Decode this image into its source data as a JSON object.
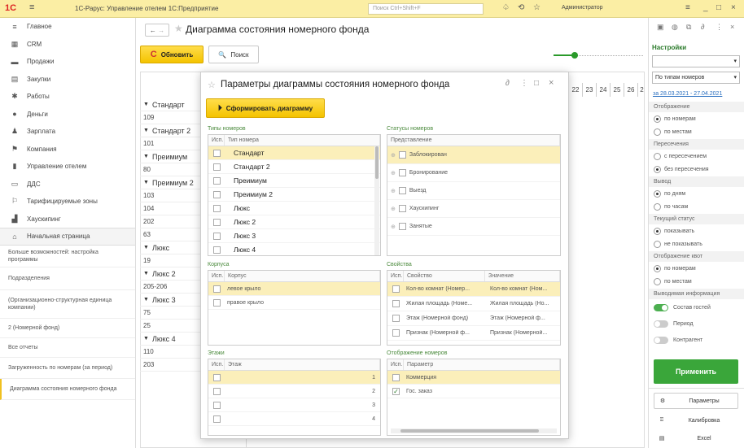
{
  "titlebar": {
    "app_title": "1С-Рарус: Управление отелем 1С:Предприятие",
    "search_placeholder": "Поиск Ctrl+Shift+F",
    "user": "Администратор"
  },
  "sidebar": {
    "items": [
      {
        "label": "Главное",
        "icon": "hamburger-icon"
      },
      {
        "label": "CRM",
        "icon": "crm-icon"
      },
      {
        "label": "Продажи",
        "icon": "sales-icon"
      },
      {
        "label": "Закупки",
        "icon": "purchases-icon"
      },
      {
        "label": "Работы",
        "icon": "works-icon"
      },
      {
        "label": "Деньги",
        "icon": "money-icon"
      },
      {
        "label": "Зарплата",
        "icon": "salary-icon"
      },
      {
        "label": "Компания",
        "icon": "company-icon"
      },
      {
        "label": "Управление отелем",
        "icon": "hotel-icon"
      },
      {
        "label": "ДДС",
        "icon": "dds-icon"
      },
      {
        "label": "Тарифицируемые зоны",
        "icon": "zones-icon"
      },
      {
        "label": "Хаускипинг",
        "icon": "housekeeping-icon"
      }
    ],
    "home": "Начальная страница",
    "links": [
      "Больше возможностей: настройка программы",
      "Подразделения",
      "(Организационно-структурная единица компании)",
      "2 (Номерной фонд)",
      "Все отчеты",
      "Загруженность по номерам (за период)",
      "Диаграмма состояния номерного фонда"
    ]
  },
  "main": {
    "page_title": "Диаграмма состояния номерного фонда",
    "refresh_label": "Обновить",
    "find_label": "Поиск",
    "days": [
      "22",
      "23",
      "24",
      "25",
      "26",
      "2"
    ],
    "rows": [
      {
        "text": "Стандарт",
        "group": true
      },
      {
        "text": "109",
        "group": false
      },
      {
        "text": "Стандарт 2",
        "group": true
      },
      {
        "text": "101",
        "group": false
      },
      {
        "text": "Преимиум",
        "group": true
      },
      {
        "text": "80",
        "group": false
      },
      {
        "text": "Преимиум 2",
        "group": true
      },
      {
        "text": "103",
        "group": false
      },
      {
        "text": "104",
        "group": false
      },
      {
        "text": "202",
        "group": false
      },
      {
        "text": "63",
        "group": false
      },
      {
        "text": "Люкс",
        "group": true
      },
      {
        "text": "19",
        "group": false
      },
      {
        "text": "Люкс 2",
        "group": true
      },
      {
        "text": "205-206",
        "group": false
      },
      {
        "text": "Люкс 3",
        "group": true
      },
      {
        "text": "75",
        "group": false
      },
      {
        "text": "25",
        "group": false
      },
      {
        "text": "Люкс 4",
        "group": true
      },
      {
        "text": "110",
        "group": false
      },
      {
        "text": "203",
        "group": false
      }
    ]
  },
  "dialog": {
    "title": "Параметры диаграммы состояния номерного фонда",
    "generate_label": "Сформировать диаграмму",
    "room_types": {
      "caption": "Типы номеров",
      "col_use": "Исп.",
      "col_name": "Тип номера",
      "rows": [
        "Стандарт",
        "Стандарт 2",
        "Преимиум",
        "Преимиум 2",
        "Люкс",
        "Люкс 2",
        "Люкс 3",
        "Люкс 4"
      ]
    },
    "statuses": {
      "caption": "Статусы номеров",
      "col_name": "Представление",
      "rows": [
        "Заблокирован",
        "Бронирование",
        "Выезд",
        "Хаускипинг",
        "Занятые"
      ]
    },
    "buildings": {
      "caption": "Корпуса",
      "col_use": "Исп.",
      "col_name": "Корпус",
      "rows": [
        "левое крыло",
        "правое крыло"
      ]
    },
    "properties": {
      "caption": "Свойства",
      "col_use": "Исп.",
      "col_prop": "Свойство",
      "col_value": "Значение",
      "rows": [
        {
          "prop": "Кол-во комнат (Номер...",
          "value": "Кол-во комнат (Ном..."
        },
        {
          "prop": "Жилая площадь (Номе...",
          "value": "Жилая площадь (Но..."
        },
        {
          "prop": "Этаж (Номерной фонд)",
          "value": "Этаж (Номерной ф..."
        },
        {
          "prop": "Признак (Номерной ф...",
          "value": "Признак (Номерной..."
        }
      ]
    },
    "floors": {
      "caption": "Этажи",
      "col_use": "Исп.",
      "col_name": "Этаж",
      "rows": [
        "1",
        "2",
        "3",
        "4"
      ]
    },
    "display": {
      "caption": "Отображение номеров",
      "col_use": "Исп.",
      "col_name": "Параметр",
      "rows": [
        {
          "label": "Коммерция",
          "checked": false
        },
        {
          "label": "Гос. заказ",
          "checked": true
        }
      ]
    }
  },
  "rpanel": {
    "settings_title": "Настройки",
    "group_by": "По типам номеров",
    "period": "за 28.03.2021 - 27.04.2021",
    "sections": {
      "display": "Отображение",
      "cross": "Пересечения",
      "output": "Вывод",
      "status": "Текущий статус",
      "quotas": "Отображение квот",
      "info": "Выводимая информация"
    },
    "options": {
      "by_rooms": "по номерам",
      "by_places": "по местам",
      "with_cross": "с пересечением",
      "without_cross": "без пересечения",
      "by_days": "по дням",
      "by_hours": "по часам",
      "show": "показывать",
      "hide": "не показывать",
      "q_rooms": "по номерам",
      "q_places": "по местам"
    },
    "toggles": [
      "Состав гостей",
      "Период",
      "Контрагент"
    ],
    "apply_label": "Применить",
    "params_label": "Параметры",
    "calibration_label": "Калибровка",
    "excel_label": "Excel"
  },
  "colors": {
    "titlebar": "#fbeea4",
    "accent_yellow": "#f4c300",
    "apply_green": "#3aa63a",
    "selected_row": "#fbefba"
  }
}
